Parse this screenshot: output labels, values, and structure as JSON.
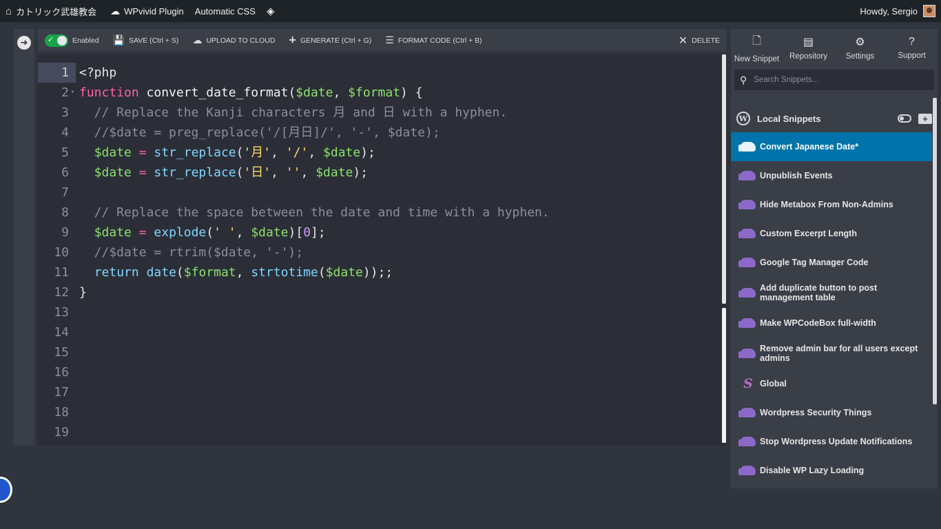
{
  "adminbar": {
    "home_label": "カトリック武雄教会",
    "plugin_label": "WPvivid Plugin",
    "css_label": "Automatic CSS",
    "howdy": "Howdy, Sergio"
  },
  "toolbar": {
    "enabled": "Enabled",
    "save": "SAVE (Ctrl + S)",
    "upload": "UPLOAD TO CLOUD",
    "generate": "GENERATE (Ctrl + G)",
    "format": "FORMAT CODE (Ctrl + B)",
    "delete": "DELETE"
  },
  "editor": {
    "line_numbers": [
      "1",
      "2",
      "3",
      "4",
      "5",
      "6",
      "7",
      "8",
      "9",
      "10",
      "11",
      "12",
      "13",
      "14",
      "15",
      "16",
      "17",
      "18",
      "19"
    ]
  },
  "right_panel": {
    "tabs": {
      "new_snippet": "New Snippet",
      "repository": "Repository",
      "settings": "Settings",
      "support": "Support"
    },
    "search_placeholder": "Search Snippets...",
    "local_header": "Local Snippets",
    "snippets": [
      "Convert Japanese Date*",
      "Unpublish Events",
      "Hide Metabox From Non-Admins",
      "Custom Excerpt Length",
      "Google Tag Manager Code",
      "Add duplicate button to post management table",
      "Make WPCodeBox full-width",
      "Remove admin bar for all users except admins",
      "Global",
      "Wordpress Security Things",
      "Stop Wordpress Update Notifications",
      "Disable WP Lazy Loading"
    ]
  }
}
